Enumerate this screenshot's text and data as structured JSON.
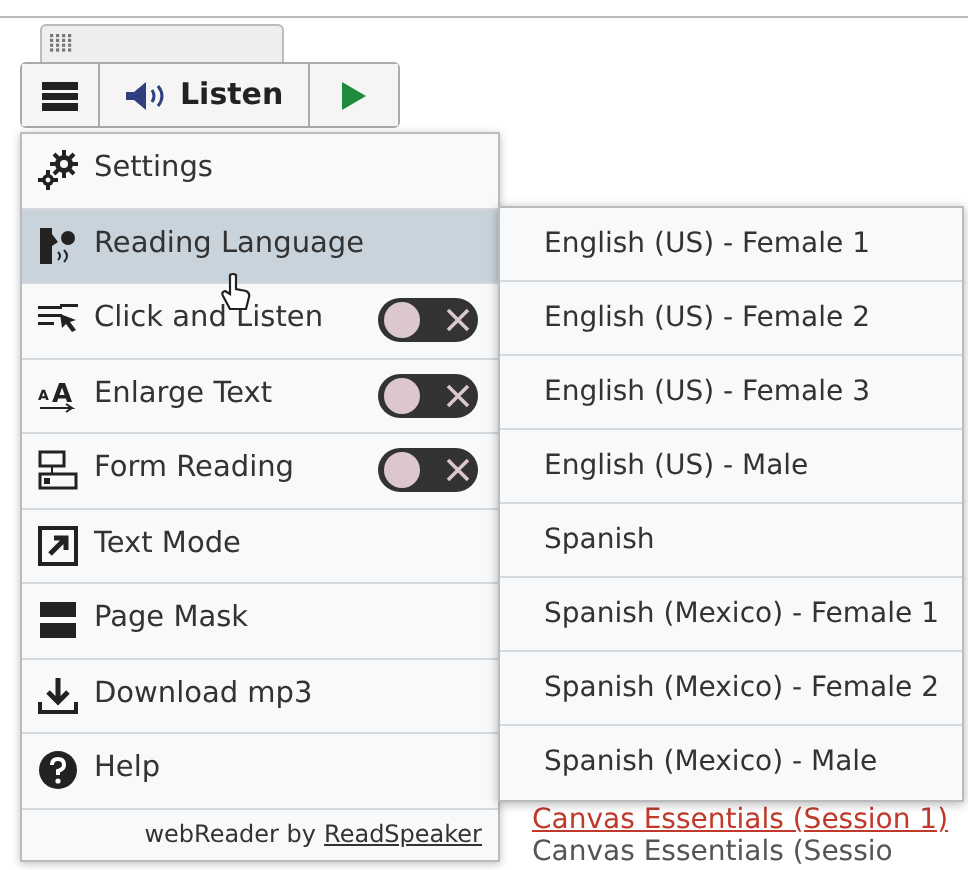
{
  "toolbar": {
    "listen_label": "Listen"
  },
  "menu": {
    "items": [
      {
        "label": "Settings",
        "kind": "link",
        "highlighted": false
      },
      {
        "label": "Reading Language",
        "kind": "submenu",
        "highlighted": true
      },
      {
        "label": "Click and Listen",
        "kind": "toggle",
        "highlighted": false,
        "on": false
      },
      {
        "label": "Enlarge Text",
        "kind": "toggle",
        "highlighted": false,
        "on": false,
        "icon_letters": [
          "A",
          "A"
        ]
      },
      {
        "label": "Form Reading",
        "kind": "toggle",
        "highlighted": false,
        "on": false
      },
      {
        "label": "Text Mode",
        "kind": "link",
        "highlighted": false
      },
      {
        "label": "Page Mask",
        "kind": "link",
        "highlighted": false
      },
      {
        "label": "Download mp3",
        "kind": "link",
        "highlighted": false
      },
      {
        "label": "Help",
        "kind": "link",
        "highlighted": false
      }
    ],
    "footer_text": "webReader by",
    "footer_link": "ReadSpeaker"
  },
  "language_menu": {
    "items": [
      {
        "label": "English (US) - Female 1"
      },
      {
        "label": "English (US) - Female 2"
      },
      {
        "label": "English (US) - Female 3"
      },
      {
        "label": "English (US) - Male"
      },
      {
        "label": "Spanish"
      },
      {
        "label": "Spanish (Mexico) - Female 1"
      },
      {
        "label": "Spanish (Mexico) - Female 2"
      },
      {
        "label": "Spanish (Mexico) - Male"
      }
    ]
  },
  "page": {
    "links": [
      "Canvas Essentials (Session 1)"
    ],
    "lines": [
      "Canvas Essentials (Sessio"
    ]
  }
}
